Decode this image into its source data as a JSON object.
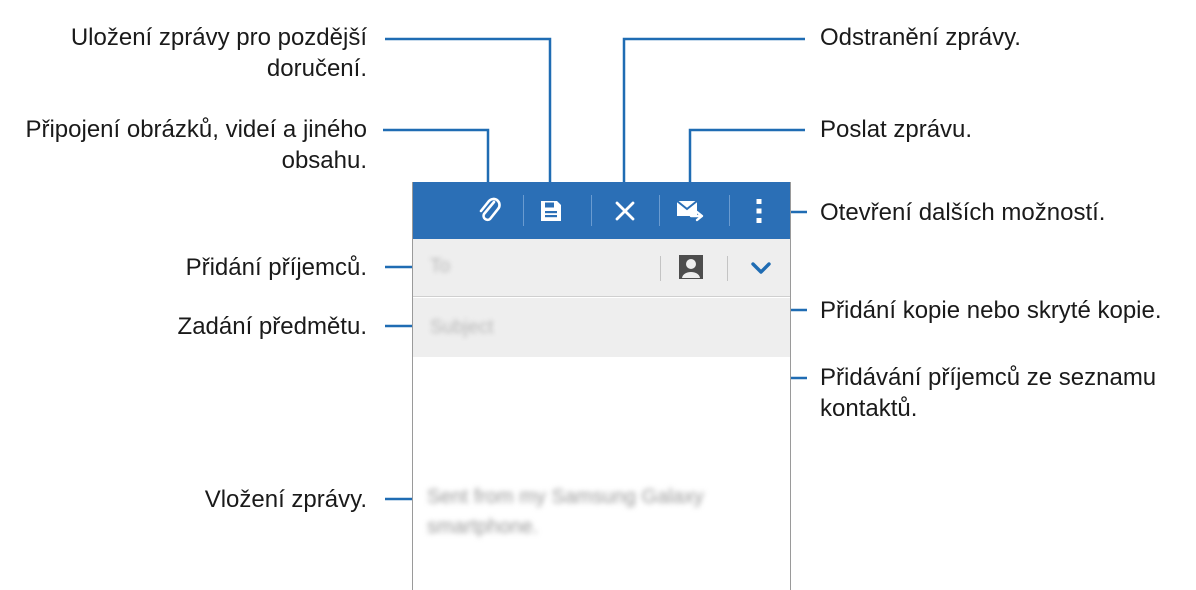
{
  "annotations": {
    "save_line1": "Uložení zprávy pro pozdější",
    "save_line2": "doručení.",
    "attach_line1": "Připojení obrázků, videí a jiného",
    "attach_line2": "obsahu.",
    "add_recipients": "Přidání příjemců.",
    "subject": "Zadání předmětu.",
    "enter_message": "Vložení zprávy.",
    "delete": "Odstranění zprávy.",
    "send": "Poslat zprávu.",
    "more_options": "Otevření dalších možností.",
    "cc_bcc": "Přidání kopie nebo skryté kopie.",
    "contacts_line1": "Přidávání příjemců ze seznamu",
    "contacts_line2": "kontaktů."
  },
  "compose": {
    "to_placeholder": "To",
    "subject_placeholder": "Subject",
    "body_text": "Sent from my Samsung Galaxy smartphone."
  },
  "icons": {
    "attach": "paperclip-icon",
    "save": "floppy-disk-icon",
    "discard": "close-icon",
    "send": "send-mail-icon",
    "more": "more-vertical-icon",
    "contacts": "contact-card-icon",
    "expand": "chevron-down-icon"
  },
  "colors": {
    "action_bar": "#2b6fb6",
    "field_background": "#eeeeee",
    "leader_lines": "#1f6cb3"
  }
}
